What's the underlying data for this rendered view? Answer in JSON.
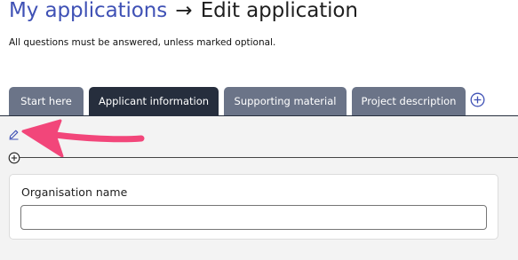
{
  "header": {
    "breadcrumb_link": "My applications",
    "separator": "→",
    "title": "Edit application",
    "subtitle": "All questions must be answered, unless marked optional."
  },
  "tabs": [
    {
      "label": "Start here",
      "active": false
    },
    {
      "label": "Applicant information",
      "active": true
    },
    {
      "label": "Supporting material",
      "active": false
    },
    {
      "label": "Project description",
      "active": false
    }
  ],
  "icons": {
    "add_tab": "plus-circle-icon",
    "edit": "pencil-icon",
    "add_section": "plus-circle-icon",
    "annotation": "pink-arrow"
  },
  "form": {
    "field_label": "Organisation name",
    "field_value": ""
  },
  "colors": {
    "link": "#3f51b5",
    "tab_active": "#262e3d",
    "tab_inactive": "#6b7488",
    "annotation_arrow": "#f2467a"
  }
}
